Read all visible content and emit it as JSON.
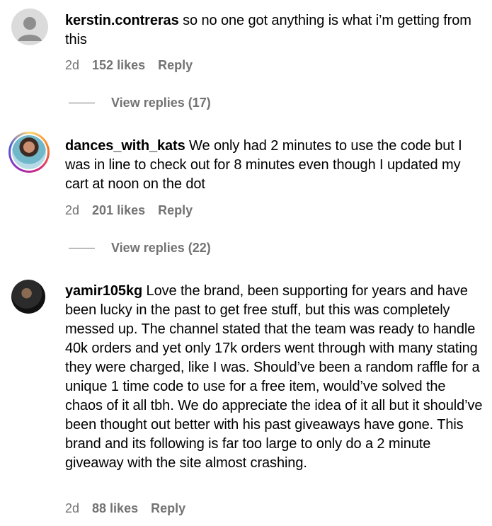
{
  "comments": [
    {
      "username": "kerstin.contreras",
      "text": " so no one got anything is what i’m getting from this",
      "age": "2d",
      "likes": "152 likes",
      "reply": "Reply",
      "view_replies": "View replies (17)",
      "avatar": "default-avatar-icon"
    },
    {
      "username": "dances_with_kats",
      "text": " We only had 2 minutes to use the code but I was in line to check out for 8 minutes even though I updated my cart at noon on the dot",
      "age": "2d",
      "likes": "201 likes",
      "reply": "Reply",
      "view_replies": "View replies (22)",
      "avatar": "story-ring-avatar"
    },
    {
      "username": "yamir105kg",
      "text": " Love the brand, been supporting for years and have been lucky in the past to get free stuff, but this was completely messed up. The channel stated that the team was ready to handle 40k orders and yet only 17k orders went through with many stating they were charged, like I was. Should’ve been a random raffle for a unique 1 time code to use for a free item, would’ve solved the chaos of it all tbh. We do appreciate the idea of it all but it should’ve been thought out better with his past giveaways have gone. This brand and its following is far too large to only do a 2 minute giveaway with the site almost crashing.",
      "age": "2d",
      "likes": "88 likes",
      "reply": "Reply",
      "avatar": "photo-avatar"
    }
  ]
}
